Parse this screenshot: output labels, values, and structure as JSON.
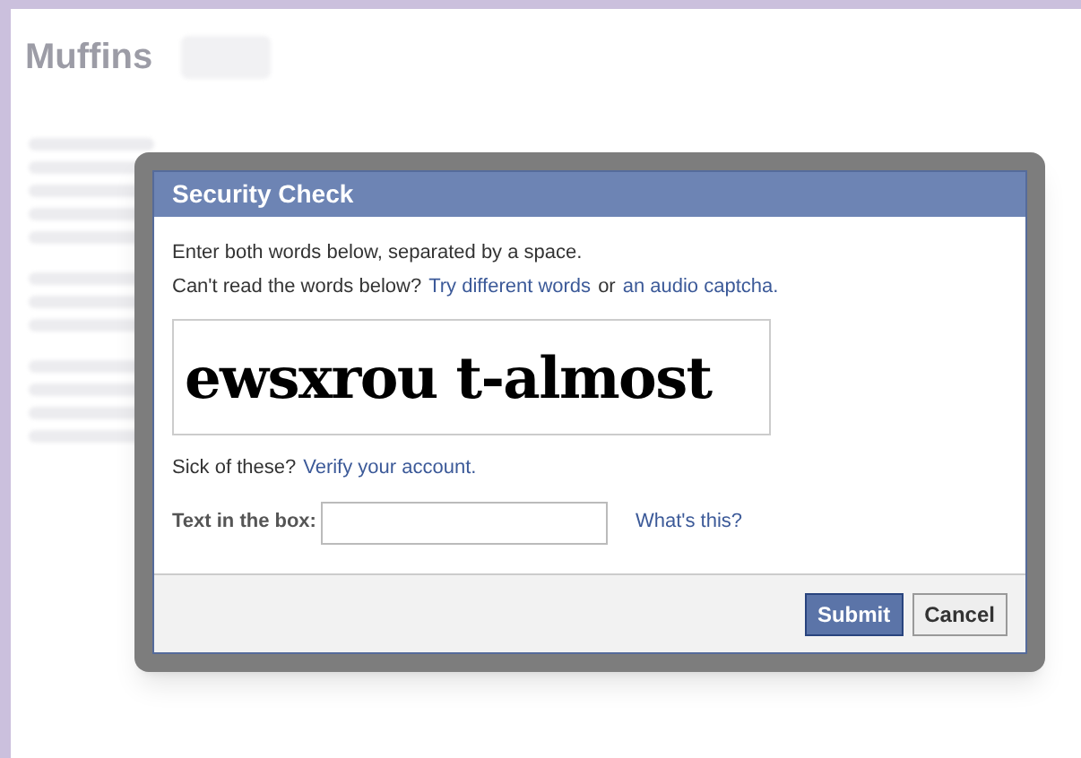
{
  "page": {
    "title": "Muffins"
  },
  "dialog": {
    "title": "Security Check",
    "instructions": "Enter both words below, separated by a space.",
    "help_prefix": "Can't read the words below?",
    "help_link_1": "Try different words",
    "help_joiner": "or",
    "help_link_2": "an audio captcha.",
    "captcha": "ewsxrou t-almost",
    "verify_prefix": "Sick of these?",
    "verify_link": "Verify your account.",
    "field_label": "Text in the box:",
    "whats_this": "What's this?",
    "buttons": [
      {
        "label": "Submit",
        "kind": "primary"
      },
      {
        "label": "Cancel",
        "kind": "secondary"
      }
    ]
  }
}
